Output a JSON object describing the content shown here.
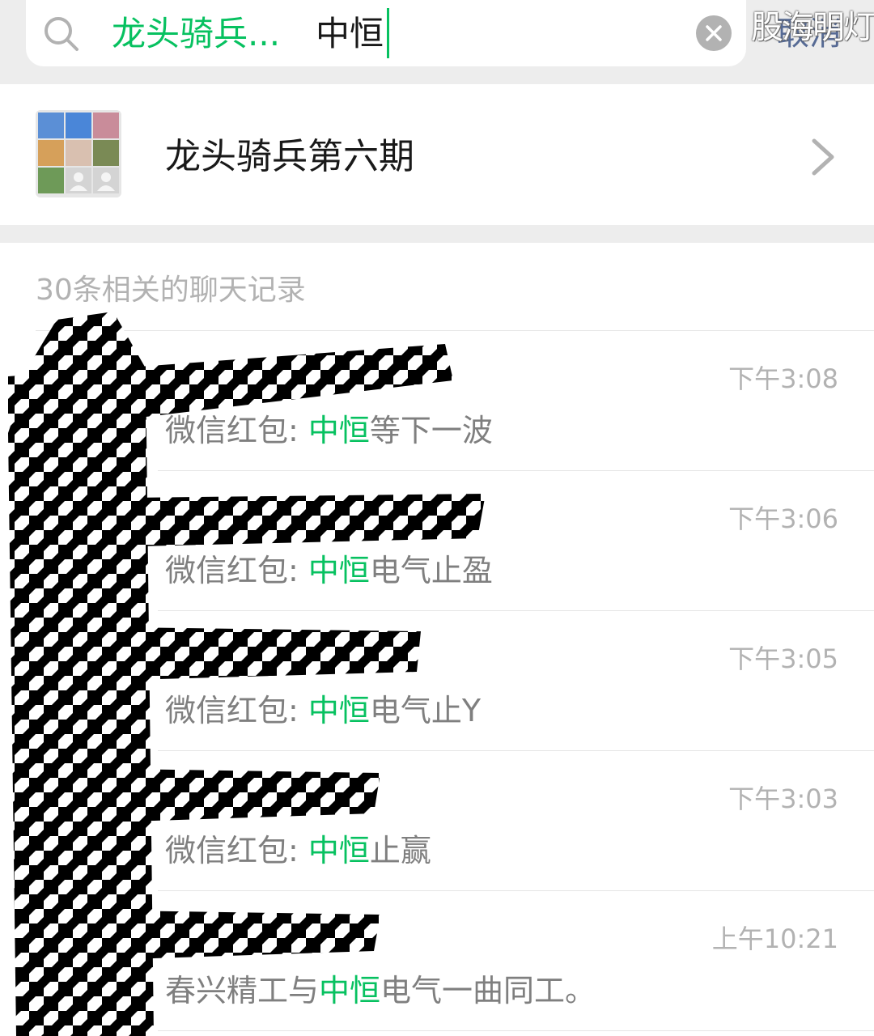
{
  "search": {
    "scope_label": "龙头骑兵...",
    "query": "中恒",
    "cancel_label": "取消",
    "watermark": "股海明灯"
  },
  "group": {
    "name": "龙头骑兵第六期"
  },
  "records": {
    "count_label": "30条相关的聊天记录",
    "items": [
      {
        "time": "下午3:08",
        "prefix": "微信红包: ",
        "keyword": "中恒",
        "suffix": "等下一波"
      },
      {
        "time": "下午3:06",
        "prefix": "微信红包: ",
        "keyword": "中恒",
        "suffix": "电气止盈"
      },
      {
        "time": "下午3:05",
        "prefix": "微信红包: ",
        "keyword": "中恒",
        "suffix": "电气止Y"
      },
      {
        "time": "下午3:03",
        "prefix": "微信红包: ",
        "keyword": "中恒",
        "suffix": "止赢"
      },
      {
        "time": "上午10:21",
        "prefix": "春兴精工与",
        "keyword": "中恒",
        "suffix": "电气一曲同工。"
      }
    ]
  },
  "colors": {
    "accent": "#07c160",
    "link": "#576b95",
    "background": "#ededed",
    "secondary_text": "#b2b2b2"
  }
}
